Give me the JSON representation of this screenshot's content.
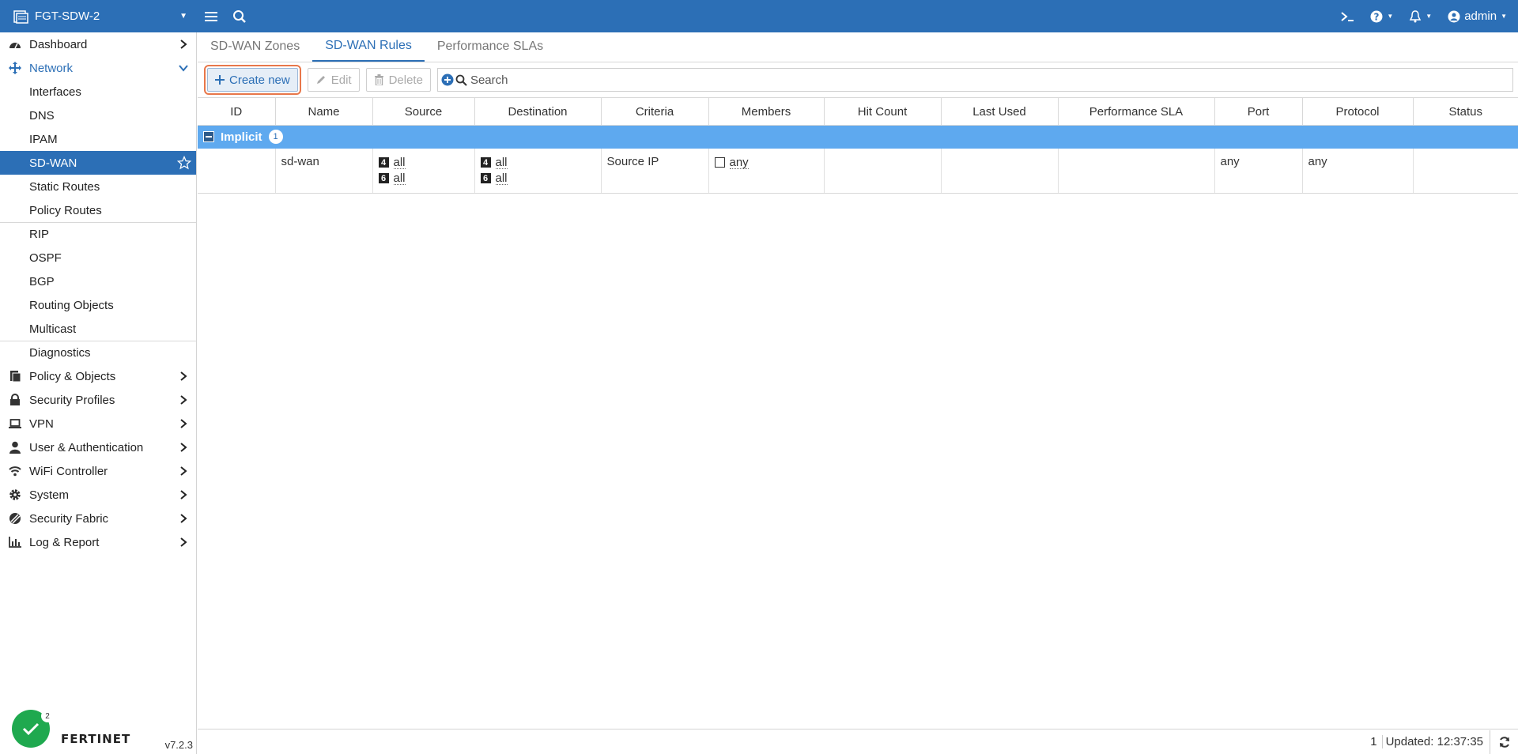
{
  "topbar": {
    "device_name": "FGT-SDW-2",
    "user": "admin",
    "accent": "#2c6fb6"
  },
  "sidebar": {
    "top_items": [
      {
        "label": "Dashboard",
        "icon": "dashboard-icon"
      },
      {
        "label": "Network",
        "icon": "network-icon"
      }
    ],
    "network_sub": [
      "Interfaces",
      "DNS",
      "IPAM",
      "SD-WAN",
      "Static Routes",
      "Policy Routes",
      "RIP",
      "OSPF",
      "BGP",
      "Routing Objects",
      "Multicast",
      "Diagnostics"
    ],
    "bottom_items": [
      {
        "label": "Policy & Objects",
        "icon": "policy-icon"
      },
      {
        "label": "Security Profiles",
        "icon": "lock-icon"
      },
      {
        "label": "VPN",
        "icon": "laptop-icon"
      },
      {
        "label": "User & Authentication",
        "icon": "user-icon"
      },
      {
        "label": "WiFi Controller",
        "icon": "wifi-icon"
      },
      {
        "label": "System",
        "icon": "gear-icon"
      },
      {
        "label": "Security Fabric",
        "icon": "fabric-icon"
      },
      {
        "label": "Log & Report",
        "icon": "chart-icon"
      }
    ],
    "notification_count": "2",
    "logo": "FERTINET",
    "version": "v7.2.3"
  },
  "tabs": [
    "SD-WAN Zones",
    "SD-WAN Rules",
    "Performance SLAs"
  ],
  "toolbar": {
    "create_label": "Create new",
    "edit_label": "Edit",
    "delete_label": "Delete",
    "search_placeholder": "Search"
  },
  "table": {
    "columns": [
      "ID",
      "Name",
      "Source",
      "Destination",
      "Criteria",
      "Members",
      "Hit Count",
      "Last Used",
      "Performance SLA",
      "Port",
      "Protocol",
      "Status"
    ],
    "group": {
      "label": "Implicit",
      "count": "1"
    },
    "row": {
      "id": "",
      "name": "sd-wan",
      "source_v4": "all",
      "source_v6": "all",
      "dest_v4": "all",
      "dest_v6": "all",
      "criteria": "Source IP",
      "members": "any",
      "hit_count": "",
      "last_used": "",
      "performance_sla": "",
      "port": "any",
      "protocol": "any",
      "status": ""
    }
  },
  "statusbar": {
    "count": "1",
    "updated": "Updated: 12:37:35"
  }
}
